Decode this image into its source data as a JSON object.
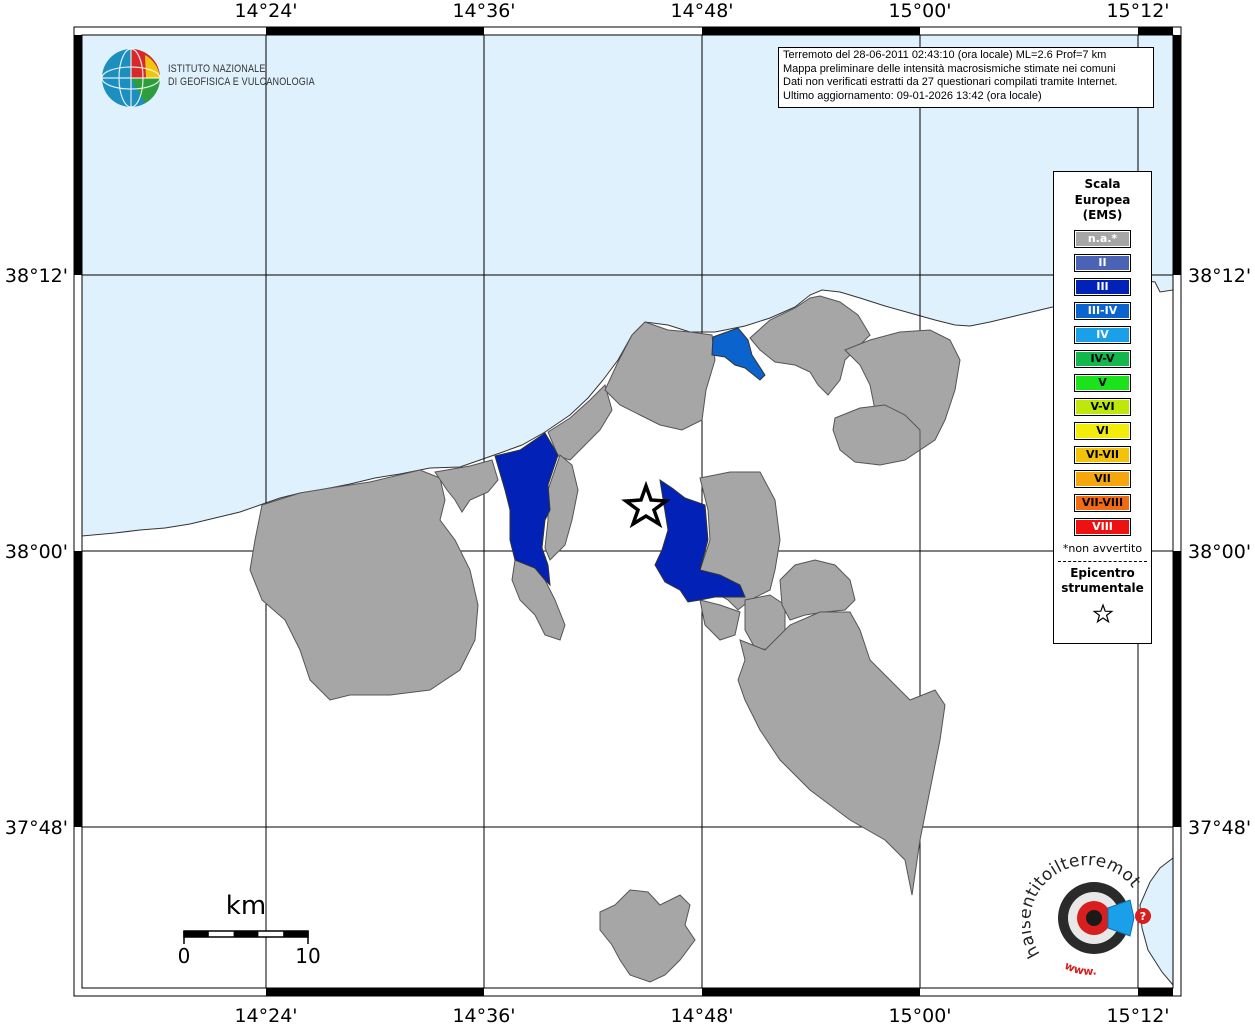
{
  "info_box": {
    "line1": "Terremoto del 28-06-2011 02:43:10 (ora locale) ML=2.6 Prof=7 km",
    "line2": "Mappa preliminare delle intensità macrosismiche stimate nei comuni",
    "line3": "Dati non verificati estratti da 27 questionari compilati tramite Internet.",
    "line4": "Ultimo aggiornamento: 09-01-2026 13:42 (ora locale)"
  },
  "ingv_logo": {
    "line1": "ISTITUTO NAZIONALE",
    "line2": "DI GEOFISICA E VULCANOLOGIA"
  },
  "axes": {
    "longitude_ticks": [
      "14°24'",
      "14°36'",
      "14°48'",
      "15°00'",
      "15°12'"
    ],
    "latitude_ticks": [
      "38°12'",
      "38°00'",
      "37°48'"
    ]
  },
  "legend": {
    "title_lines": [
      "Scala",
      "Europea",
      "(EMS)"
    ],
    "items": [
      {
        "label": "n.a.*",
        "color": "#a6a6a6",
        "text_color": "light"
      },
      {
        "label": "II",
        "color": "#4a63b4",
        "text_color": "light"
      },
      {
        "label": "III",
        "color": "#0222b7",
        "text_color": "light"
      },
      {
        "label": "III-IV",
        "color": "#0b63cd",
        "text_color": "light"
      },
      {
        "label": "IV",
        "color": "#1aa0e8",
        "text_color": "light"
      },
      {
        "label": "IV-V",
        "color": "#12b84c",
        "text_color": "dark"
      },
      {
        "label": "V",
        "color": "#1ce21c",
        "text_color": "dark"
      },
      {
        "label": "V-VI",
        "color": "#bde80a",
        "text_color": "dark"
      },
      {
        "label": "VI",
        "color": "#f3ec0a",
        "text_color": "dark"
      },
      {
        "label": "VI-VII",
        "color": "#f3c20a",
        "text_color": "dark"
      },
      {
        "label": "VII",
        "color": "#f5a60c",
        "text_color": "dark"
      },
      {
        "label": "VII-VIII",
        "color": "#f26a12",
        "text_color": "dark"
      },
      {
        "label": "VIII",
        "color": "#ee1111",
        "text_color": "light"
      }
    ],
    "note": "*non avvertito",
    "epicenter_lines": [
      "Epicentro",
      "strumentale"
    ]
  },
  "scale_bar": {
    "unit": "km",
    "min_label": "0",
    "max_label": "10"
  },
  "haisentito_logo": {
    "text": "haisentitoilterremoto.it",
    "prefix": "www."
  },
  "colors": {
    "sea": "#dff1fd",
    "land": "#ffffff",
    "not_felt": "#a6a6a6",
    "intensity_III": "#0222b7",
    "intensity_III_IV": "#0b63cd"
  }
}
